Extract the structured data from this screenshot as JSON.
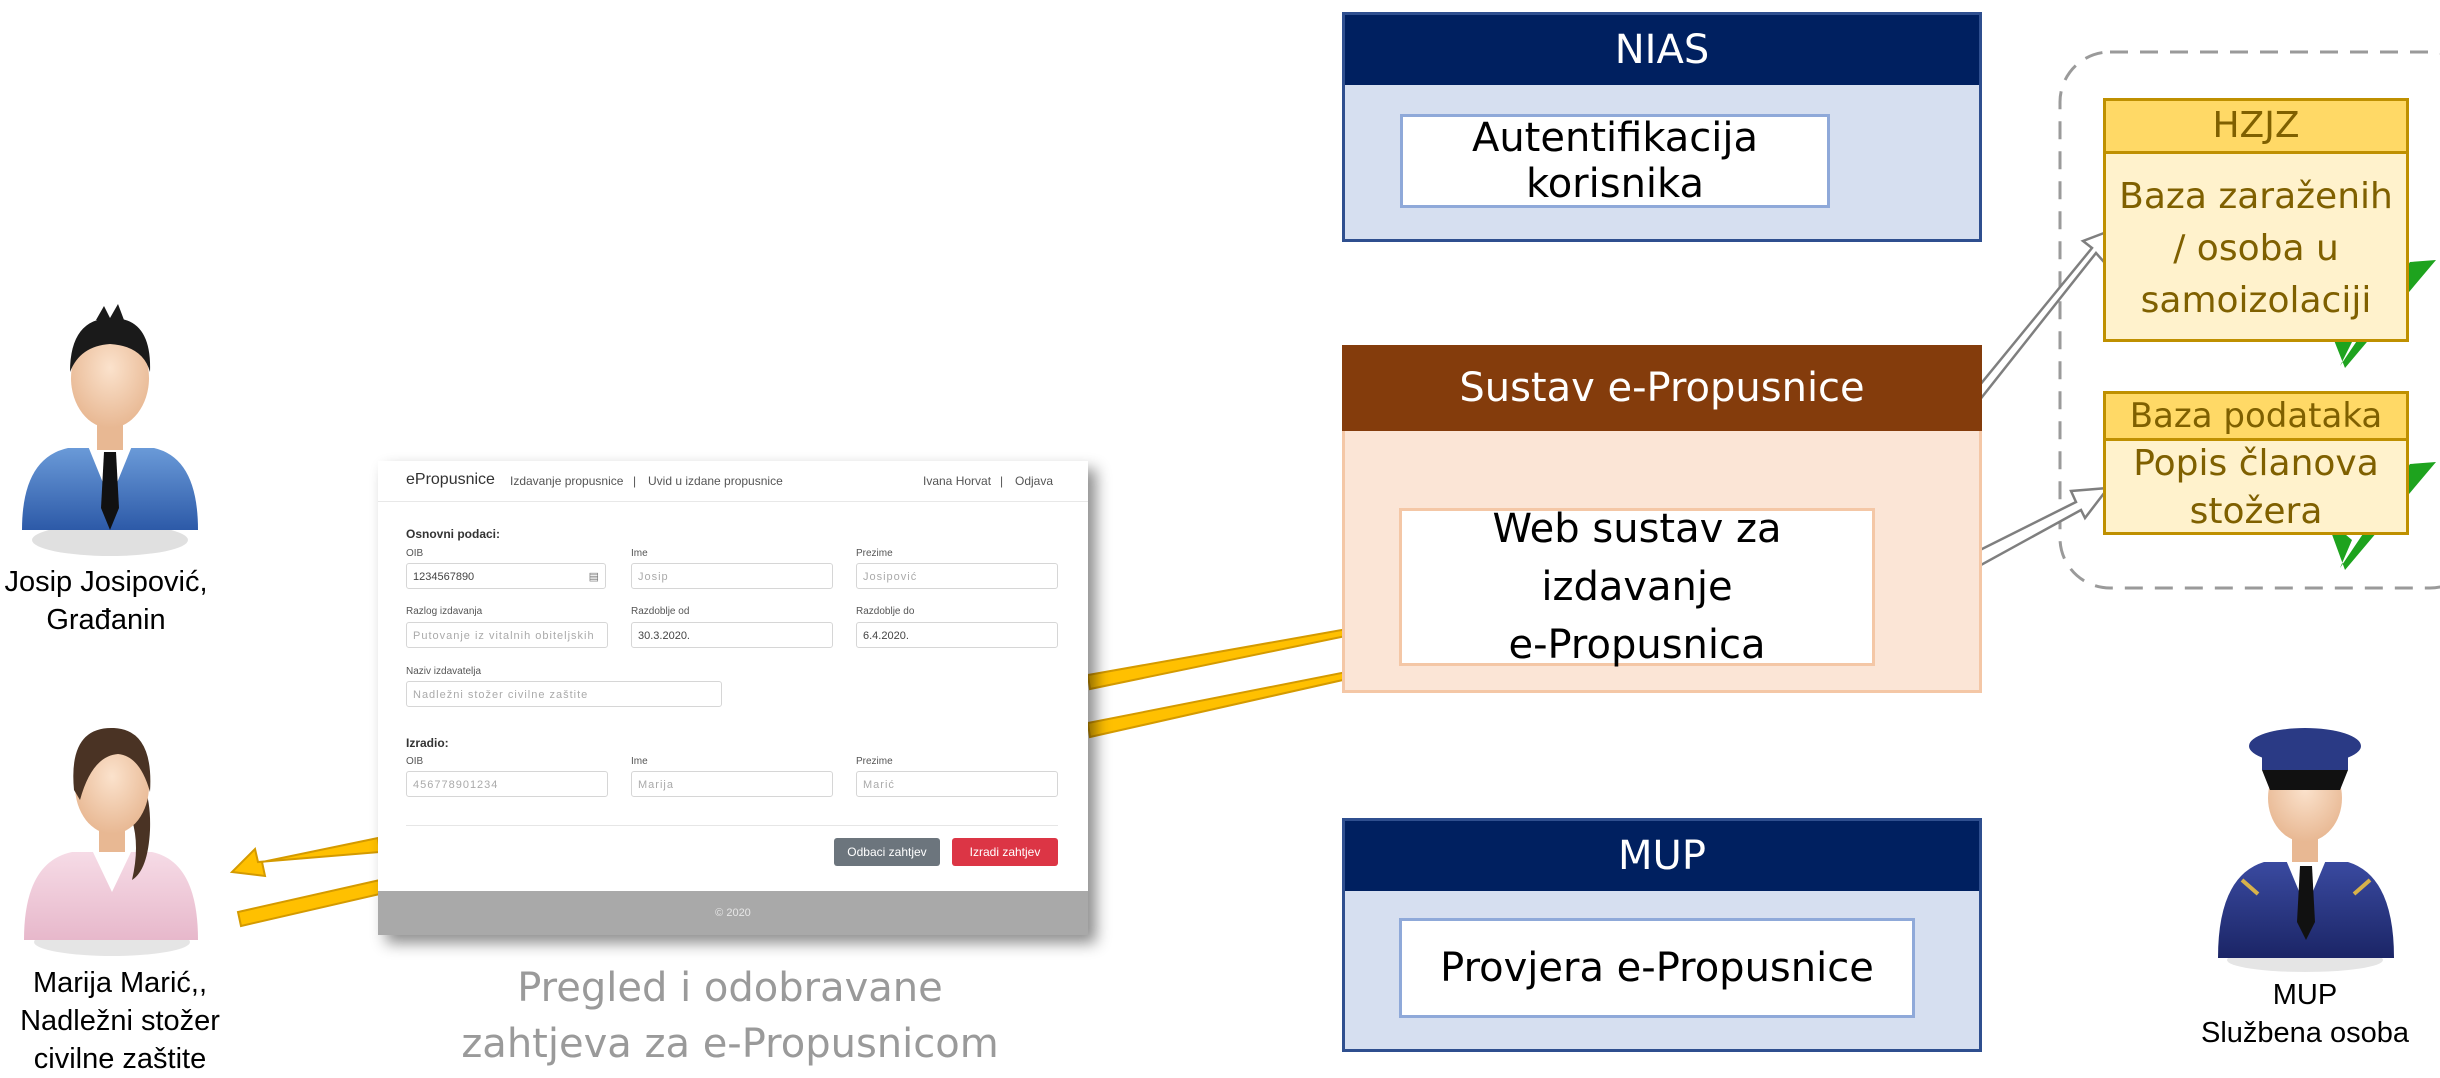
{
  "actors": {
    "citizen": {
      "line1": "Josip Josipović,",
      "line2": "Građanin"
    },
    "official": {
      "line1": "Marija Marić,,",
      "line2": "Nadležni stožer",
      "line3": "civilne zaštite"
    },
    "police": {
      "line1": "MUP",
      "line2": "Službena osoba"
    }
  },
  "screenshot": {
    "brand": "ePropusnice",
    "nav_issue": "Izdavanje propusnice",
    "nav_sep": "|",
    "nav_view": "Uvid u izdane propusnice",
    "user": "Ivana Horvat",
    "user_sep": "|",
    "logout": "Odjava",
    "section_basic": "Osnovni podaci:",
    "oib_label": "OIB",
    "oib_value": "1234567890",
    "ime_label": "Ime",
    "ime_value": "Josip",
    "prezime_label": "Prezime",
    "prezime_value": "Josipović",
    "razlog_label": "Razlog izdavanja",
    "razlog_value": "Putovanje iz vitalnih obiteljskih",
    "od_label": "Razdoblje od",
    "od_value": "30.3.2020.",
    "do_label": "Razdoblje do",
    "do_value": "6.4.2020.",
    "izdavatelj_label": "Naziv izdavatelja",
    "izdavatelj_value": "Nadležni stožer civilne zaštite",
    "section_made": "Izradio:",
    "oib2_label": "OIB",
    "oib2_value": "456778901234",
    "ime2_label": "Ime",
    "ime2_value": "Marija",
    "prezime2_label": "Prezime",
    "prezime2_value": "Marić",
    "reject_button": "Odbaci zahtjev",
    "create_button": "Izradi zahtjev",
    "footer": "© 2020"
  },
  "screenshot_caption": {
    "line1": "Pregled i odobravane",
    "line2": "zahtjeva za e-Propusnicom"
  },
  "nias": {
    "title": "NIAS",
    "item": "Autentifikacija korisnika"
  },
  "sustav": {
    "title": "Sustav e-Propusnice",
    "item_line1": "Web sustav za izdavanje",
    "item_line2": "e-Propusnica"
  },
  "mup": {
    "title": "MUP",
    "item": "Provjera e-Propusnice"
  },
  "hzjz": {
    "title": "HZJZ",
    "line1": "Baza zaraženih",
    "line2": "/ osoba u",
    "line3": "samoizolaciji"
  },
  "baza": {
    "title": "Baza podataka",
    "line1": "Popis članova",
    "line2": "stožera"
  },
  "colors": {
    "navy": "#002060",
    "navy_border": "#2f4f8f",
    "light_blue": "#d6dff0",
    "brown": "#843c0c",
    "peach": "#fbe5d6",
    "gold": "#ffd966",
    "light_yellow": "#fff2cc",
    "gold_border": "#bf9000",
    "arrow_yellow": "#ffc000",
    "check_green": "#1ea31e",
    "danger": "#dc3545",
    "secondary": "#6c757d"
  }
}
